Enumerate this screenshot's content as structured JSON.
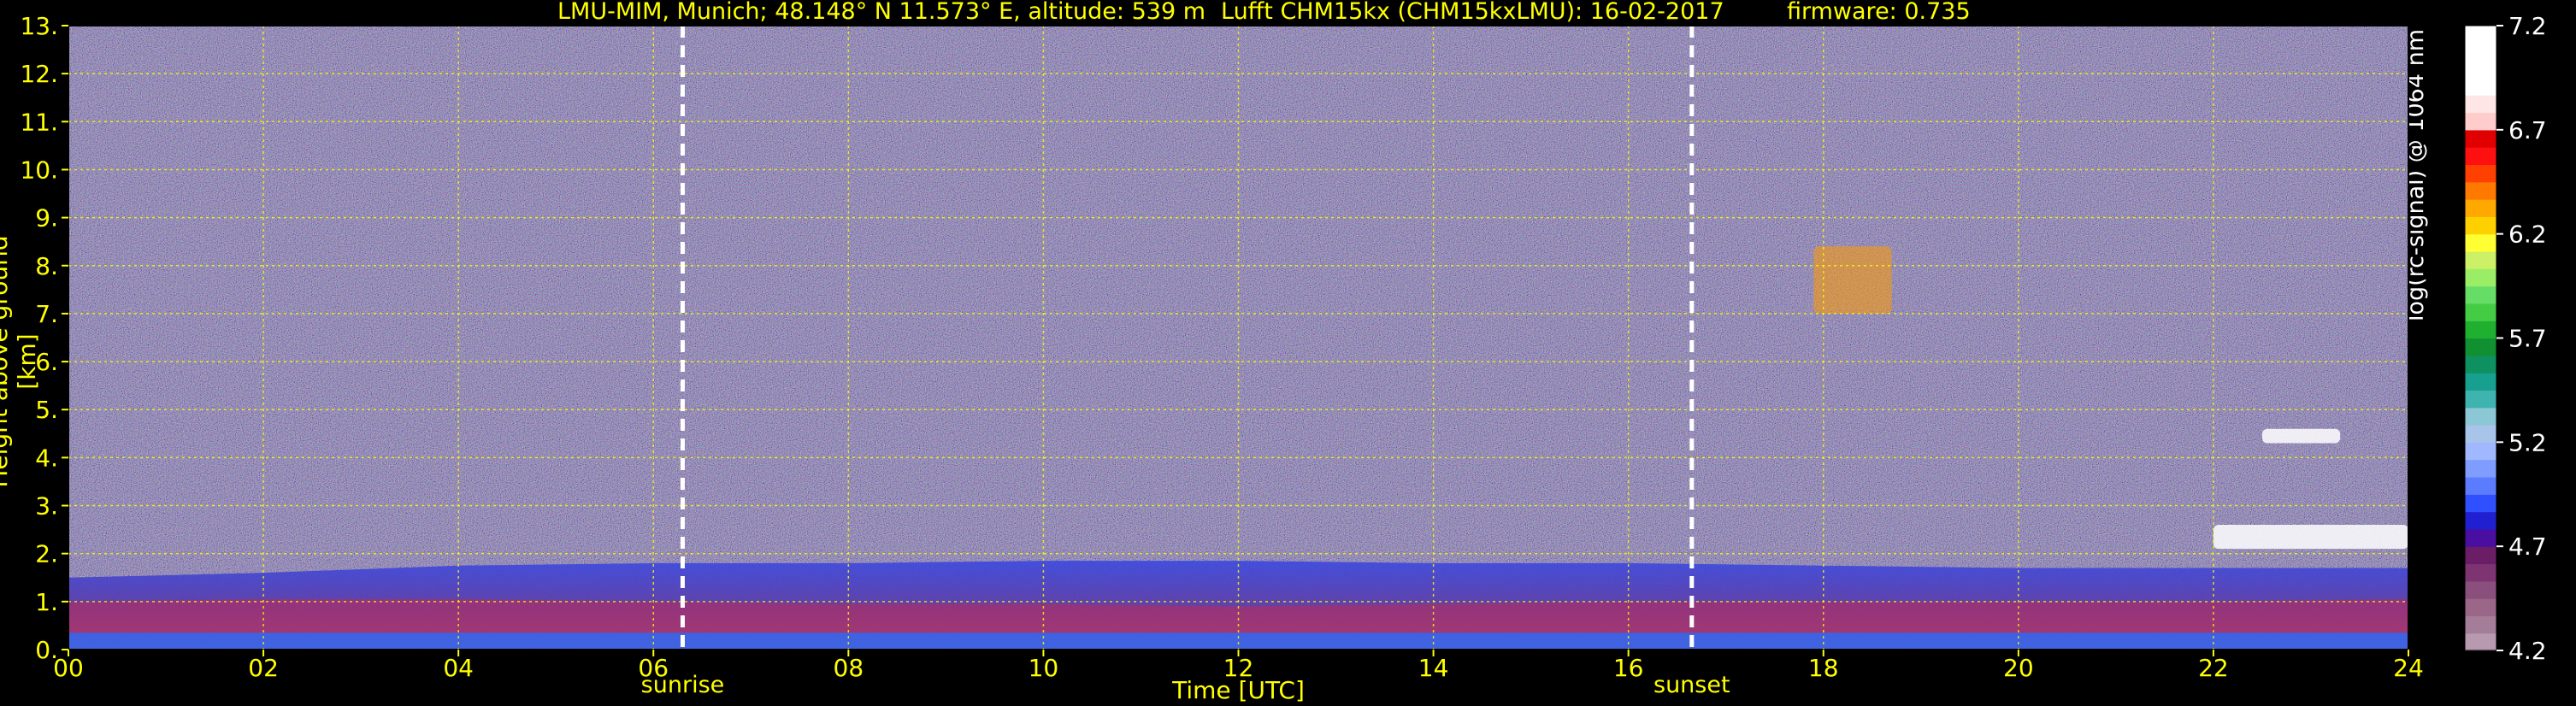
{
  "header": {
    "station": "LMU-MIM, Munich; 48.148° N 11.573° E, altitude: 539 m",
    "instrument": "Lufft CHM15kx (CHM15kxLMU): 16-02-2017",
    "firmware": "firmware: 0.735"
  },
  "chart_data": {
    "type": "heatmap",
    "xlabel": "Time [UTC]",
    "ylabel": "Height above ground [km]",
    "x_ticks": [
      "00",
      "02",
      "04",
      "06",
      "08",
      "10",
      "12",
      "14",
      "16",
      "18",
      "20",
      "22",
      "24"
    ],
    "x_tick_values": [
      0,
      2,
      4,
      6,
      8,
      10,
      12,
      14,
      16,
      18,
      20,
      22,
      24
    ],
    "y_ticks": [
      "0.",
      "1.",
      "2.",
      "3.",
      "4.",
      "5.",
      "6.",
      "7.",
      "8.",
      "9.",
      "10.",
      "11.",
      "12.",
      "13."
    ],
    "y_tick_values": [
      0,
      1,
      2,
      3,
      4,
      5,
      6,
      7,
      8,
      9,
      10,
      11,
      12,
      13
    ],
    "xlim": [
      0,
      24
    ],
    "ylim": [
      0,
      13
    ],
    "grid": true,
    "annotations": [
      {
        "label": "sunrise",
        "time": 6.3
      },
      {
        "label": "sunset",
        "time": 16.65
      }
    ],
    "layers": [
      {
        "desc": "boundary layer top",
        "height_km": [
          1.5,
          1.6,
          1.75,
          1.8,
          1.8,
          1.85,
          1.85,
          1.8,
          1.8,
          1.75,
          1.7,
          1.7,
          1.7
        ]
      },
      {
        "desc": "aerosol layer",
        "height_km": [
          1.0,
          1.05,
          1.05,
          1.0,
          0.95,
          0.95,
          0.9,
          0.95,
          1.0,
          1.0,
          1.0,
          1.0,
          1.05
        ]
      }
    ],
    "features": [
      {
        "desc": "cloud",
        "time": [
          17.9,
          18.7
        ],
        "height_km": [
          7.0,
          8.4
        ]
      },
      {
        "desc": "cloud",
        "time": [
          22.5,
          23.3
        ],
        "height_km": [
          4.3,
          4.6
        ]
      },
      {
        "desc": "cloud",
        "time": [
          22.0,
          24.0
        ],
        "height_km": [
          2.1,
          2.6
        ]
      }
    ],
    "colorbar": {
      "label": "log(rc-signal) @ 1064 nm",
      "ticks": [
        "4.2",
        "4.7",
        "5.2",
        "5.7",
        "6.2",
        "6.7",
        "7.2"
      ],
      "range": [
        4.2,
        7.2
      ],
      "colors": [
        "#b79aaf",
        "#a47d98",
        "#9a6789",
        "#8b4f7d",
        "#7d3470",
        "#6b1e66",
        "#4a0fa0",
        "#2020d0",
        "#3050ff",
        "#5b7cff",
        "#7f9cff",
        "#9fb8ff",
        "#a8c4e8",
        "#8cc7d5",
        "#3fb3b0",
        "#17a090",
        "#0e9060",
        "#109030",
        "#20b030",
        "#44cc44",
        "#66dd66",
        "#99ee66",
        "#ccf066",
        "#ffff33",
        "#ffd000",
        "#ffa800",
        "#ff7800",
        "#ff4000",
        "#ff1010",
        "#e00000",
        "#ffcccc",
        "#ffe6e6",
        "#ffffff",
        "#ffffff",
        "#ffffff",
        "#ffffff"
      ]
    }
  }
}
